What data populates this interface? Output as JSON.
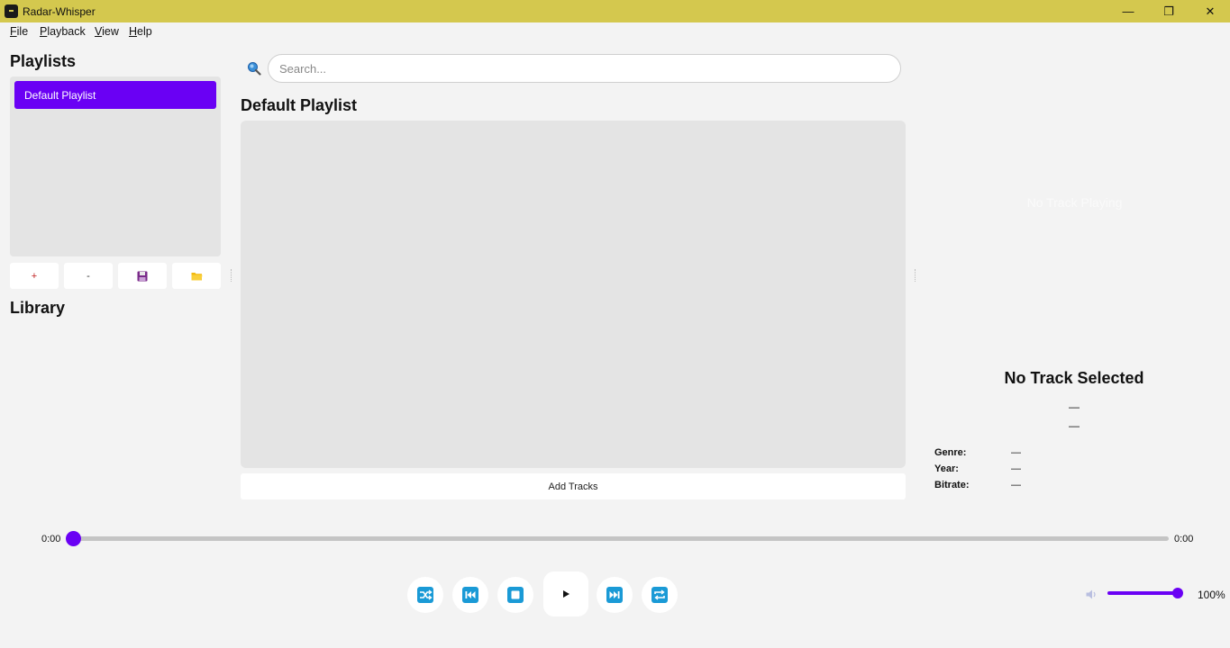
{
  "window": {
    "title": "Radar-Whisper",
    "minimize": "—",
    "restore": "❐",
    "close": "✕"
  },
  "menu": [
    {
      "key": "F",
      "rest": "ile"
    },
    {
      "key": "P",
      "rest": "layback"
    },
    {
      "key": "V",
      "rest": "iew"
    },
    {
      "key": "H",
      "rest": "elp"
    }
  ],
  "sidebar": {
    "playlists_title": "Playlists",
    "playlists": [
      {
        "label": "Default Playlist",
        "selected": true
      }
    ],
    "buttons": {
      "add": "+",
      "remove": "-",
      "save_icon": "save-icon",
      "open_icon": "folder-icon"
    },
    "library_title": "Library"
  },
  "search": {
    "placeholder": "Search...",
    "value": ""
  },
  "main": {
    "playlist_title": "Default Playlist",
    "add_tracks": "Add Tracks"
  },
  "now_playing": {
    "status_text": "No Track Playing",
    "track_title": "No Track Selected",
    "artist": "—",
    "album": "—",
    "meta": [
      {
        "label": "Genre:",
        "value": "—"
      },
      {
        "label": "Year:",
        "value": "—"
      },
      {
        "label": "Bitrate:",
        "value": "—"
      }
    ]
  },
  "seek": {
    "current": "0:00",
    "total": "0:00",
    "progress": 0
  },
  "controls": {
    "shuffle_icon": "shuffle-icon",
    "previous_icon": "previous-icon",
    "stop_icon": "stop-icon",
    "play_icon": "play-icon",
    "next_icon": "next-icon",
    "repeat_icon": "repeat-icon"
  },
  "volume": {
    "label": "100%",
    "level": 1.0
  },
  "colors": {
    "accent": "#6a00f4",
    "titlebar": "#d4c84e",
    "control_icon": "#1a9ad6"
  }
}
